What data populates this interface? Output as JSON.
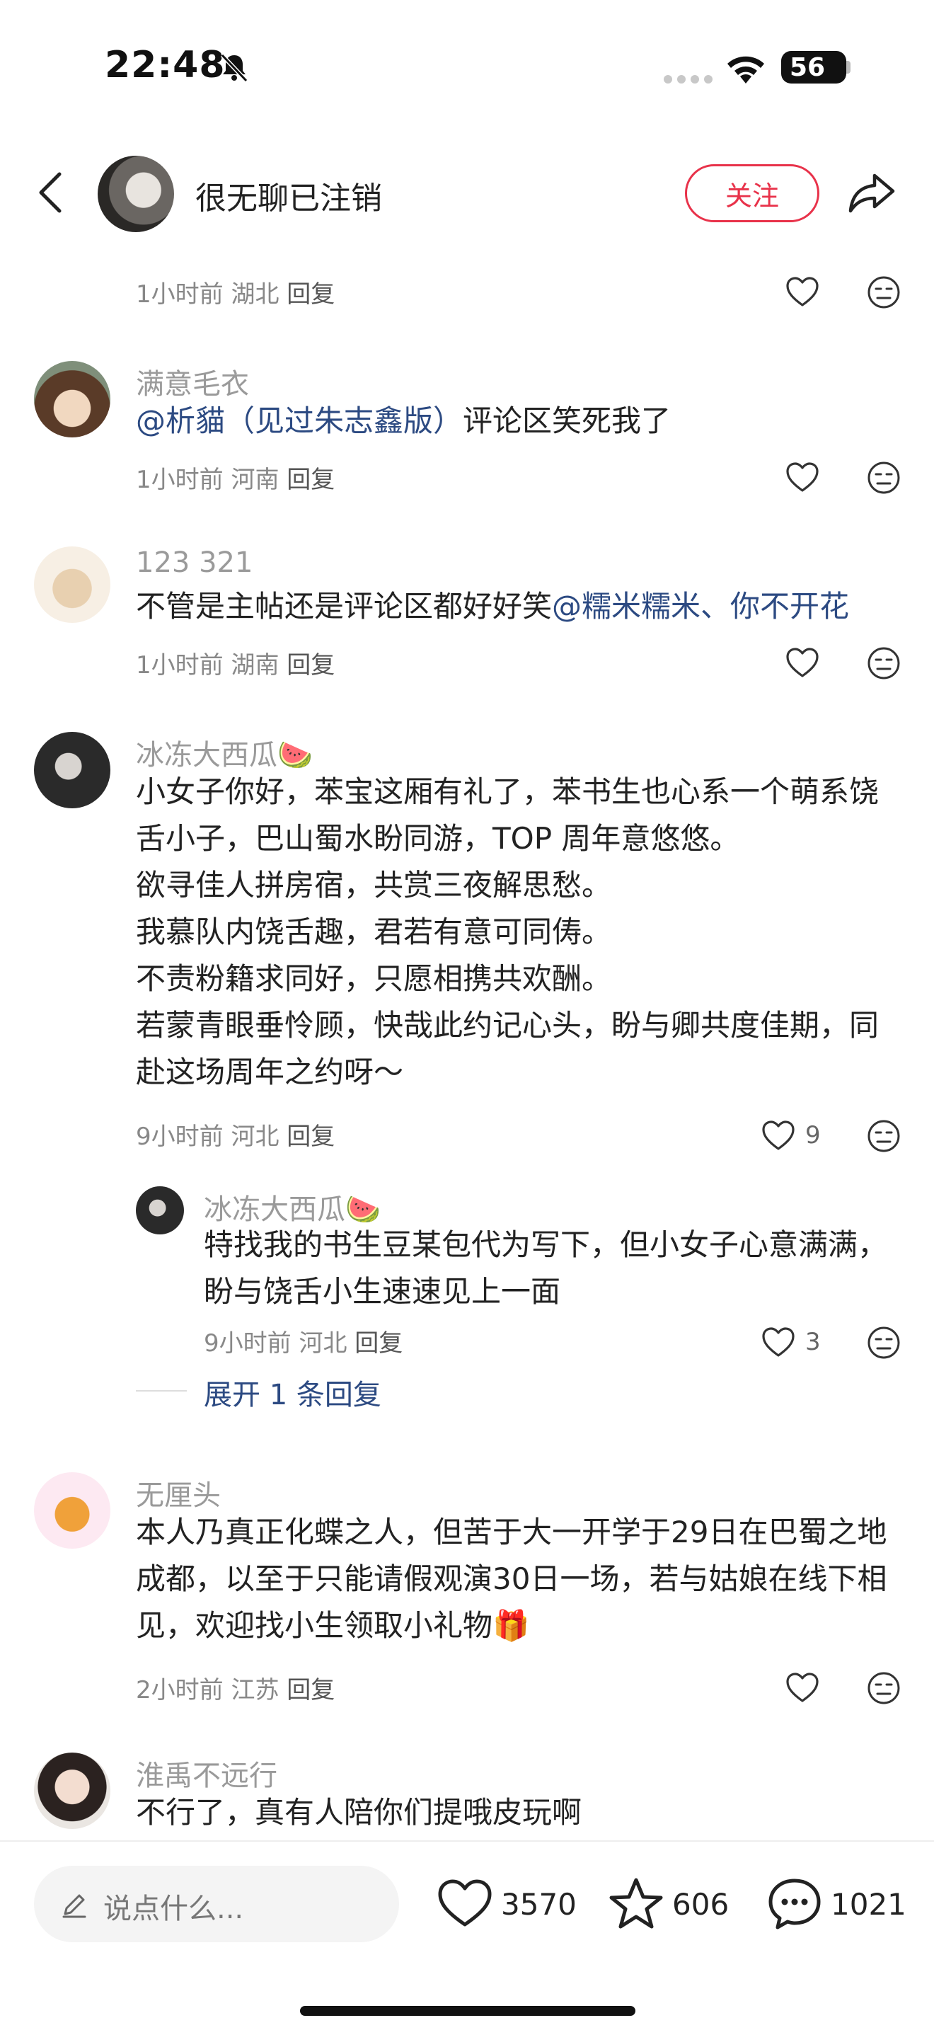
{
  "status_bar": {
    "time": "22:48",
    "battery": "56",
    "icons": [
      "bell-slash-icon",
      "signal-icon",
      "wifi-icon",
      "battery-icon"
    ]
  },
  "header": {
    "title": "很无聊已注销",
    "follow_label": "关注",
    "icons": [
      "back-icon",
      "share-icon"
    ]
  },
  "comments": [
    {
      "meta": {
        "time": "1小时前",
        "location": "湖北",
        "reply": "回复"
      }
    },
    {
      "username": "满意毛衣",
      "mention": "@析貓（见过朱志鑫版）",
      "text": "评论区笑死我了",
      "meta": {
        "time": "1小时前",
        "location": "河南",
        "reply": "回复"
      }
    },
    {
      "username": "123 321",
      "text": "不管是主帖还是评论区都好好笑",
      "mention": "@糯米糯米、你不开花",
      "meta": {
        "time": "1小时前",
        "location": "湖南",
        "reply": "回复"
      }
    },
    {
      "username": "冰冻大西瓜🍉",
      "lines": [
        "小女子你好，苯宝这厢有礼了，苯书生也心系一个萌系饶",
        "舌小子，巴山蜀水盼同游，TOP 周年意悠悠。",
        "欲寻佳人拼房宿，共赏三夜解思愁。",
        "我慕队内饶舌趣，君若有意可同俦。",
        "不责粉籍求同好，只愿相携共欢酬。",
        "若蒙青眼垂怜顾，快哉此约记心头，盼与卿共度佳期，同",
        "赴这场周年之约呀～"
      ],
      "meta": {
        "time": "9小时前",
        "location": "河北",
        "reply": "回复"
      },
      "likes": "9",
      "reply": {
        "username": "冰冻大西瓜🍉",
        "lines": [
          "特找我的书生豆某包代为写下，但小女子心意满满，",
          "盼与饶舌小生速速见上一面"
        ],
        "meta": {
          "time": "9小时前",
          "location": "河北",
          "reply": "回复"
        },
        "likes": "3"
      },
      "expand_label": "展开 1 条回复"
    },
    {
      "username": "无厘头",
      "lines": [
        "本人乃真正化蝶之人，但苦于大一开学于29日在巴蜀之地",
        "成都，以至于只能请假观演30日一场，若与姑娘在线下相",
        "见，欢迎找小生领取小礼物🎁"
      ],
      "meta": {
        "time": "2小时前",
        "location": "江苏",
        "reply": "回复"
      }
    },
    {
      "username": "淮禹不远行",
      "lines": [
        "不行了，真有人陪你们提哦皮玩啊"
      ]
    }
  ],
  "bottom_bar": {
    "input_placeholder": "说点什么...",
    "likes": "3570",
    "favorites": "606",
    "comments": "1021"
  },
  "colors": {
    "accent": "#e8324a",
    "mention": "#2c4a82",
    "muted": "#9a9a9a"
  }
}
